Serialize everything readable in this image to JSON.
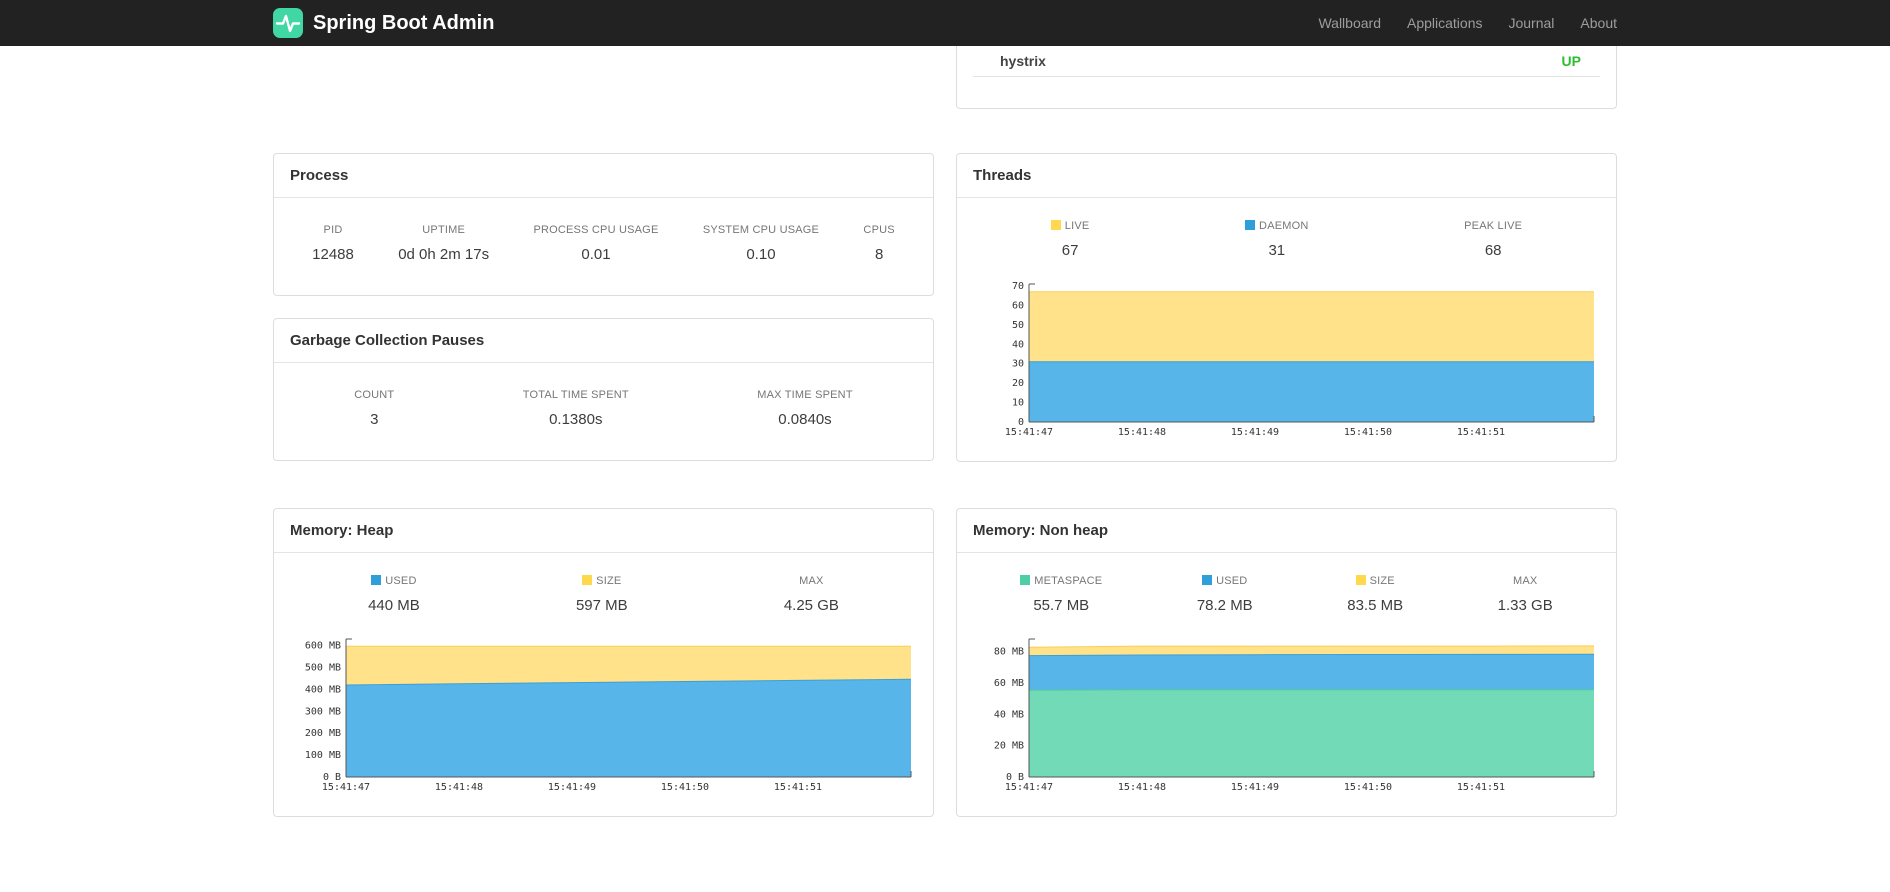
{
  "navbar": {
    "brand": "Spring Boot Admin",
    "links": [
      "Wallboard",
      "Applications",
      "Journal",
      "About"
    ]
  },
  "health_panel": {
    "rows": [
      {
        "name": "hystrix",
        "status": "UP",
        "status_color": "#2ebd2e"
      }
    ]
  },
  "process": {
    "title": "Process",
    "metrics": [
      {
        "label": "PID",
        "value": "12488"
      },
      {
        "label": "UPTIME",
        "value": "0d 0h 2m 17s"
      },
      {
        "label": "PROCESS CPU USAGE",
        "value": "0.01"
      },
      {
        "label": "SYSTEM CPU USAGE",
        "value": "0.10"
      },
      {
        "label": "CPUS",
        "value": "8"
      }
    ]
  },
  "gc": {
    "title": "Garbage Collection Pauses",
    "metrics": [
      {
        "label": "COUNT",
        "value": "3"
      },
      {
        "label": "TOTAL TIME SPENT",
        "value": "0.1380s"
      },
      {
        "label": "MAX TIME SPENT",
        "value": "0.0840s"
      }
    ]
  },
  "threads": {
    "title": "Threads",
    "legend": [
      {
        "label": "LIVE",
        "value": "67",
        "swatch": "#ffd84d"
      },
      {
        "label": "DAEMON",
        "value": "31",
        "swatch": "#2f9fd9"
      },
      {
        "label": "PEAK LIVE",
        "value": "68",
        "swatch": null
      }
    ]
  },
  "heap": {
    "title": "Memory: Heap",
    "legend": [
      {
        "label": "USED",
        "value": "440 MB",
        "swatch": "#2f9fd9"
      },
      {
        "label": "SIZE",
        "value": "597 MB",
        "swatch": "#ffd84d"
      },
      {
        "label": "MAX",
        "value": "4.25 GB",
        "swatch": null
      }
    ]
  },
  "nonheap": {
    "title": "Memory: Non heap",
    "legend": [
      {
        "label": "METASPACE",
        "value": "55.7 MB",
        "swatch": "#4fcda6"
      },
      {
        "label": "USED",
        "value": "78.2 MB",
        "swatch": "#2f9fd9"
      },
      {
        "label": "SIZE",
        "value": "83.5 MB",
        "swatch": "#ffd84d"
      },
      {
        "label": "MAX",
        "value": "1.33 GB",
        "swatch": null
      }
    ]
  },
  "chart_data": [
    {
      "type": "area",
      "title": "Threads",
      "x": [
        "15:41:47",
        "15:41:48",
        "15:41:49",
        "15:41:50",
        "15:41:51"
      ],
      "ymax": 71,
      "yticks": [
        {
          "v": 0,
          "label": "0"
        },
        {
          "v": 10,
          "label": "10"
        },
        {
          "v": 20,
          "label": "20"
        },
        {
          "v": 30,
          "label": "30"
        },
        {
          "v": 40,
          "label": "40"
        },
        {
          "v": 50,
          "label": "50"
        },
        {
          "v": 60,
          "label": "60"
        },
        {
          "v": 70,
          "label": "70"
        }
      ],
      "series": [
        {
          "name": "LIVE",
          "fill": "#ffe289",
          "stroke": "#f8cf57",
          "values": [
            67,
            67,
            67,
            67,
            67,
            67
          ]
        },
        {
          "name": "DAEMON",
          "fill": "#58b5e9",
          "stroke": "#3aa0d8",
          "values": [
            31,
            31,
            31,
            31,
            31,
            31
          ]
        }
      ]
    },
    {
      "type": "area",
      "title": "Memory: Heap",
      "x": [
        "15:41:47",
        "15:41:48",
        "15:41:49",
        "15:41:50",
        "15:41:51"
      ],
      "ymax": 630,
      "yticks": [
        {
          "v": 0,
          "label": "0 B"
        },
        {
          "v": 100,
          "label": "100 MB"
        },
        {
          "v": 200,
          "label": "200 MB"
        },
        {
          "v": 300,
          "label": "300 MB"
        },
        {
          "v": 400,
          "label": "400 MB"
        },
        {
          "v": 500,
          "label": "500 MB"
        },
        {
          "v": 600,
          "label": "600 MB"
        }
      ],
      "series": [
        {
          "name": "SIZE",
          "fill": "#ffe289",
          "stroke": "#f8cf57",
          "values": [
            597,
            597,
            597,
            597,
            597,
            597
          ]
        },
        {
          "name": "USED",
          "fill": "#58b5e9",
          "stroke": "#3aa0d8",
          "values": [
            420,
            426,
            431,
            436,
            441,
            446
          ]
        }
      ]
    },
    {
      "type": "area",
      "title": "Memory: Non heap",
      "x": [
        "15:41:47",
        "15:41:48",
        "15:41:49",
        "15:41:50",
        "15:41:51"
      ],
      "ymax": 88,
      "yticks": [
        {
          "v": 0,
          "label": "0 B"
        },
        {
          "v": 20,
          "label": "20 MB"
        },
        {
          "v": 40,
          "label": "40 MB"
        },
        {
          "v": 60,
          "label": "60 MB"
        },
        {
          "v": 80,
          "label": "80 MB"
        }
      ],
      "series": [
        {
          "name": "SIZE",
          "fill": "#ffe289",
          "stroke": "#f8cf57",
          "values": [
            82.8,
            83.5,
            83.5,
            83.5,
            83.5,
            83.6
          ]
        },
        {
          "name": "USED",
          "fill": "#58b5e9",
          "stroke": "#3aa0d8",
          "values": [
            77.4,
            77.8,
            78.0,
            78.1,
            78.2,
            78.3
          ]
        },
        {
          "name": "METASPACE",
          "fill": "#73dab7",
          "stroke": "#50c9a0",
          "values": [
            55.4,
            55.6,
            55.6,
            55.7,
            55.7,
            55.7
          ]
        }
      ]
    }
  ]
}
